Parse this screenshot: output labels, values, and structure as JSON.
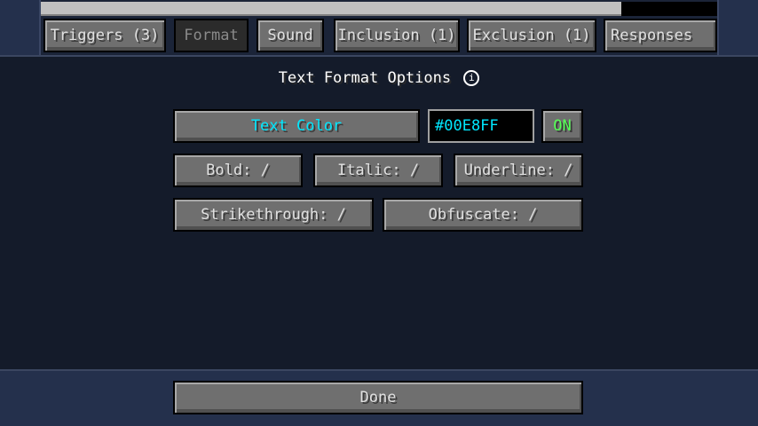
{
  "tabs": [
    {
      "label": "Triggers (3)"
    },
    {
      "label": "Format"
    },
    {
      "label": "Sound"
    },
    {
      "label": "Inclusion (1)"
    },
    {
      "label": "Exclusion (1)"
    },
    {
      "label": "Responses"
    }
  ],
  "panel": {
    "title": "Text Format Options",
    "info_icon": "i",
    "text_color_label": "Text Color",
    "hex_value": "#00E8FF",
    "toggle_label": "ON",
    "bold_label": "Bold: /",
    "italic_label": "Italic: /",
    "underline_label": "Underline: /",
    "strikethrough_label": "Strikethrough: /",
    "obfuscate_label": "Obfuscate: /"
  },
  "footer": {
    "done_label": "Done"
  },
  "colors": {
    "accent": "#00E8FF",
    "on": "#55FF55",
    "background": "#141B2A"
  }
}
